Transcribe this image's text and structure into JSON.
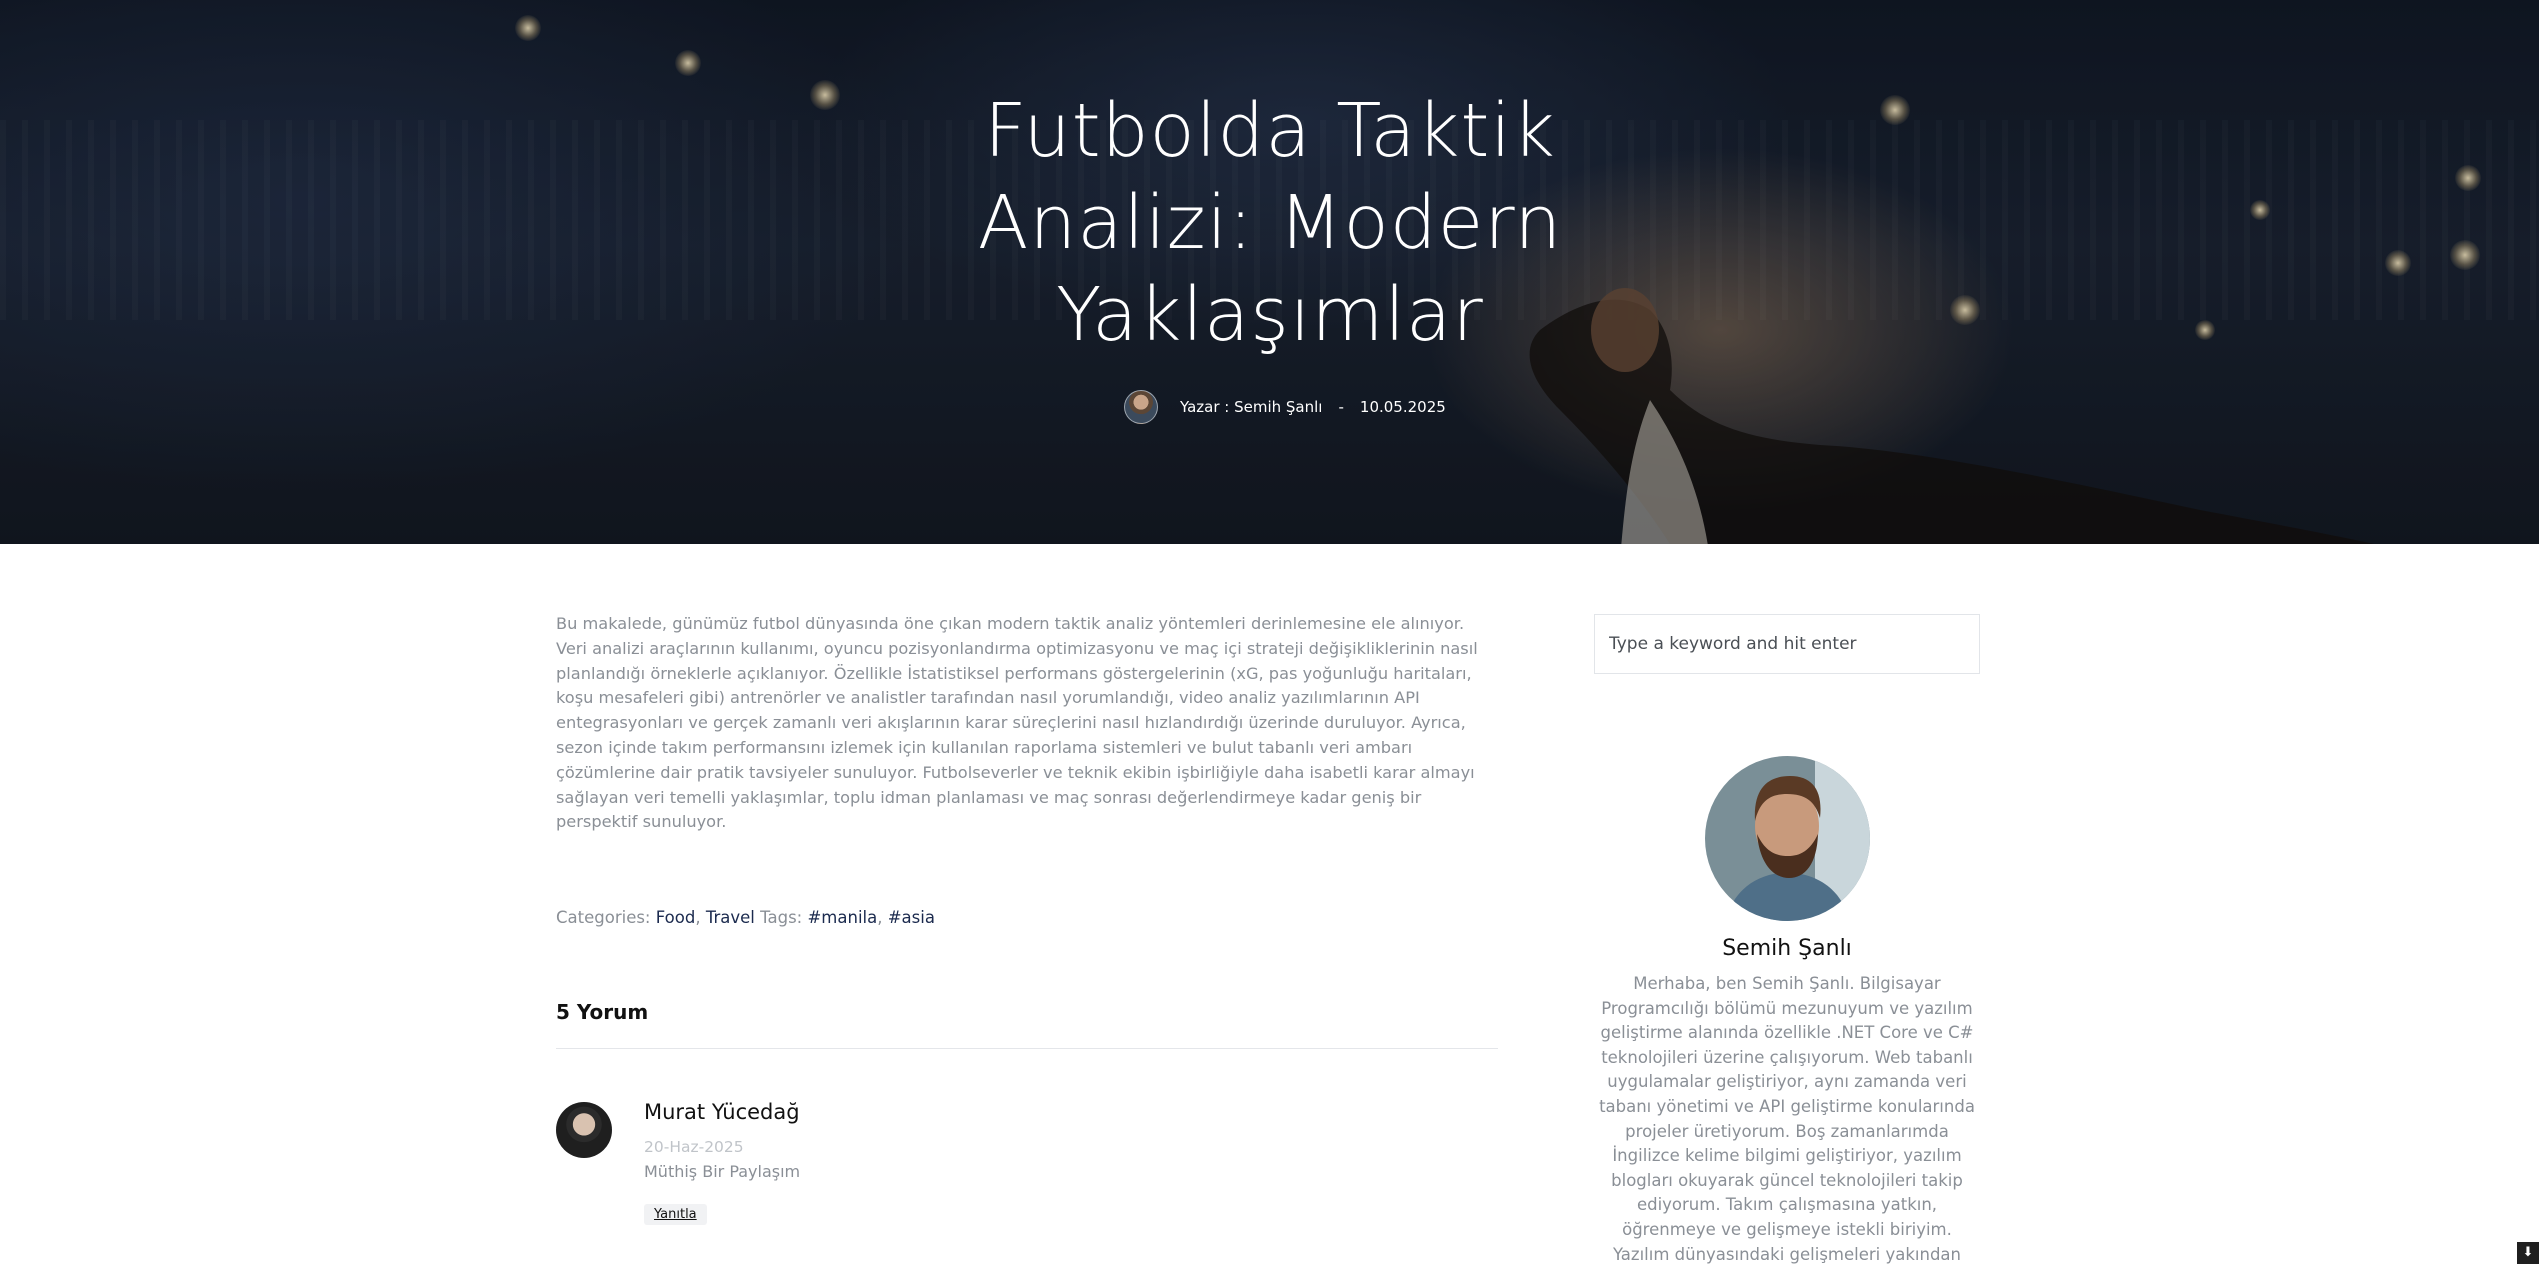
{
  "hero": {
    "title": "Futbolda Taktik Analizi: Modern Yaklaşımlar",
    "author_label": "Yazar : Semih Şanlı",
    "separator": "-",
    "date": "10.05.2025"
  },
  "article": {
    "body": "Bu makalede, günümüz futbol dünyasında öne çıkan modern taktik analiz yöntemleri derinlemesine ele alınıyor. Veri analizi araçlarının kullanımı, oyuncu pozisyonlandırma optimizasyonu ve maç içi strateji değişikliklerinin nasıl planlandığı örneklerle açıklanıyor. Özellikle İstatistiksel performans göstergelerinin (xG, pas yoğunluğu haritaları, koşu mesafeleri gibi) antrenörler ve analistler tarafından nasıl yorumlandığı, video analiz yazılımlarının API entegrasyonları ve gerçek zamanlı veri akışlarının karar süreçlerini nasıl hızlandırdığı üzerinde duruluyor. Ayrıca, sezon içinde takım performansını izlemek için kullanılan raporlama sistemleri ve bulut tabanlı veri ambarı çözümlerine dair pratik tavsiyeler sunuluyor. Futbolseverler ve teknik ekibin işbirliğiyle daha isabetli karar almayı sağlayan veri temelli yaklaşımlar, toplu idman planlaması ve maç sonrası değerlendirmeye kadar geniş bir perspektif sunuluyor."
  },
  "taxonomy": {
    "categories_label": "Categories:",
    "categories": [
      "Food",
      "Travel"
    ],
    "tags_label": "Tags:",
    "tags": [
      "#manila",
      "#asia"
    ],
    "comma": ","
  },
  "comments": {
    "heading": "5 Yorum",
    "items": [
      {
        "name": "Murat Yücedağ",
        "date": "20-Haz-2025",
        "text": "Müthiş Bir Paylaşım",
        "reply_label": "Yanıtla"
      }
    ]
  },
  "sidebar": {
    "search_placeholder": "Type a keyword and hit enter",
    "author_name": "Semih Şanlı",
    "author_bio": "Merhaba, ben Semih Şanlı. Bilgisayar Programcılığı bölümü mezunuyum ve yazılım geliştirme alanında özellikle .NET Core ve C# teknolojileri üzerine çalışıyorum. Web tabanlı uygulamalar geliştiriyor, aynı zamanda veri tabanı yönetimi ve API geliştirme konularında projeler üretiyorum. Boş zamanlarımda İngilizce kelime bilgimi geliştiriyor, yazılım blogları okuyarak güncel teknolojileri takip ediyorum. Takım çalışmasına yatkın, öğrenmeye ve gelişmeye istekli biriyim. Yazılım dünyasındaki gelişmeleri yakından takip ederek kendi"
  },
  "colors": {
    "link": "#1b2a4e",
    "muted_text": "#8a8f96",
    "hero_bg": "#141a24"
  },
  "icons": {
    "corner": "download-icon"
  }
}
